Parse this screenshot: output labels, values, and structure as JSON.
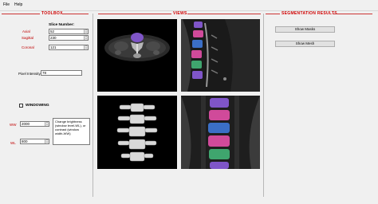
{
  "menu": {
    "file": "File",
    "help": "Help"
  },
  "sections": {
    "toolbox": "TOOLBOX",
    "views": "VIEWS",
    "segmentation": "SEGMENTATION RESULTS"
  },
  "slice": {
    "heading": "Slice Number:",
    "axial_label": "Axial",
    "axial_value": "52",
    "sagittal_label": "Sagittal",
    "sagittal_value": "230",
    "coronal_label": "Coronal",
    "coronal_value": "121"
  },
  "pixel_intensity": {
    "label": "Pixel Intensity",
    "value": "78"
  },
  "windowing": {
    "label": "WINDOWING",
    "checked": false,
    "ww_label": "WW",
    "ww_value": "2000",
    "wl_label": "WL",
    "wl_value": "800",
    "hint": "Change brightness (window level-WL), or contrast (window width-WW)"
  },
  "buttons": {
    "show_masks": "Show Masks",
    "show_mesh": "Show Mesh"
  },
  "views": {
    "axial": "axial-ct-view",
    "sagittal": "sagittal-ct-view",
    "mesh": "3d-spine-mesh-view",
    "coronal": "coronal-ct-view"
  },
  "colors": {
    "accent_red": "#d00000",
    "mask_purple": "#7f55c8",
    "mask_pink": "#d04a9a",
    "mask_green": "#3fa56e",
    "mask_blue": "#3b6fc6"
  }
}
